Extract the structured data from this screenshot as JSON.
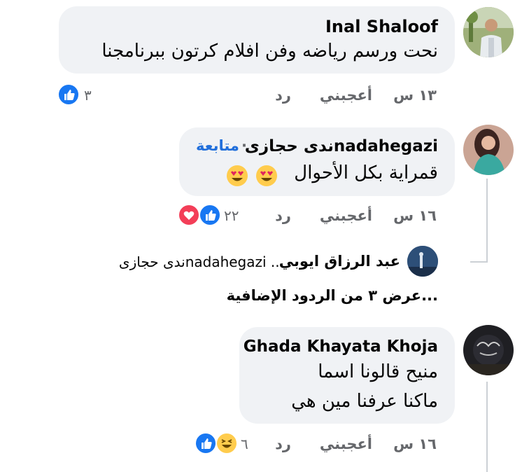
{
  "comments": [
    {
      "author": "Inal Shaloof",
      "text": "نحت ورسم رياضه وفن افلام كرتون ببرنامجنا",
      "time": "١٣ س",
      "like": "أعجبني",
      "reply": "رد",
      "reaction_count": "٣"
    },
    {
      "author": "ندى حجازىnadahegazi",
      "follow": "متابعة",
      "separator": "·",
      "text": "قمراية بكل الأحوال",
      "time": "١٦ س",
      "like": "أعجبني",
      "reply": "رد",
      "reaction_count": "٢٢"
    },
    {
      "author": "Ghada Khayata Khoja",
      "text_line1": "منيح قالونا اسما",
      "text_line2": "ماكنا عرفنا مين هي",
      "time": "١٦ س",
      "like": "أعجبني",
      "reply": "رد",
      "reaction_count": "٦"
    }
  ],
  "reply_preview": {
    "author": "عبد الرزاق ايوبي",
    "text": "ندى حجازىnadahegazi ..."
  },
  "more_replies": "عرض ٣ من الردود الإضافية...",
  "colors": {
    "like_blue": "#1877f2",
    "love_red": "#f33e58",
    "bubble_bg": "#f0f2f5",
    "meta_gray": "#65676b",
    "follow_blue": "#216fdb"
  }
}
